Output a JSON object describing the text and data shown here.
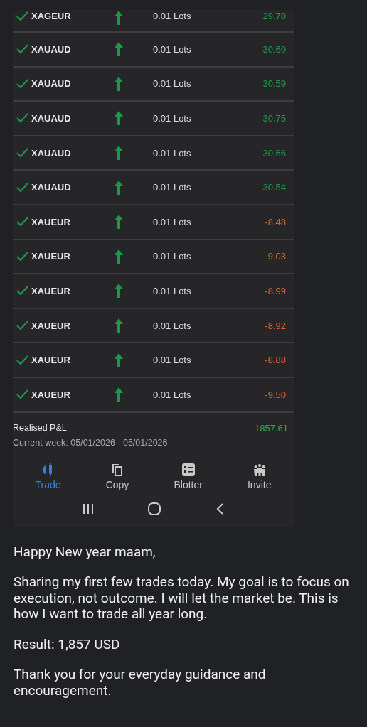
{
  "trades": [
    {
      "symbol": "XAGEUR",
      "lots": "0.01 Lots",
      "pnl": "29.70",
      "color": "#1f9a4a"
    },
    {
      "symbol": "XAUAUD",
      "lots": "0.01 Lots",
      "pnl": "30.60",
      "color": "#1f9a4a"
    },
    {
      "symbol": "XAUAUD",
      "lots": "0.01 Lots",
      "pnl": "30.59",
      "color": "#1f9a4a"
    },
    {
      "symbol": "XAUAUD",
      "lots": "0.01 Lots",
      "pnl": "30.75",
      "color": "#1f9a4a"
    },
    {
      "symbol": "XAUAUD",
      "lots": "0.01 Lots",
      "pnl": "30.66",
      "color": "#1f9a4a"
    },
    {
      "symbol": "XAUAUD",
      "lots": "0.01 Lots",
      "pnl": "30.54",
      "color": "#1f9a4a"
    },
    {
      "symbol": "XAUEUR",
      "lots": "0.01 Lots",
      "pnl": "-8.48",
      "color": "#e0623c"
    },
    {
      "symbol": "XAUEUR",
      "lots": "0.01 Lots",
      "pnl": "-9.03",
      "color": "#e0623c"
    },
    {
      "symbol": "XAUEUR",
      "lots": "0.01 Lots",
      "pnl": "-8.99",
      "color": "#e0623c"
    },
    {
      "symbol": "XAUEUR",
      "lots": "0.01 Lots",
      "pnl": "-8.92",
      "color": "#e0623c"
    },
    {
      "symbol": "XAUEUR",
      "lots": "0.01 Lots",
      "pnl": "-8.88",
      "color": "#e0623c"
    },
    {
      "symbol": "XAUEUR",
      "lots": "0.01 Lots",
      "pnl": "-9.50",
      "color": "#e0623c"
    }
  ],
  "summary": {
    "label": "Realised P&L",
    "value": "1857.61",
    "period": "Current week: 05/01/2026 - 05/01/2026"
  },
  "nav": [
    {
      "label": "Trade",
      "selected": true
    },
    {
      "label": "Copy",
      "selected": false
    },
    {
      "label": "Blotter",
      "selected": false
    },
    {
      "label": "Invite",
      "selected": false
    }
  ],
  "message": [
    "Happy New year maam,",
    "Sharing my first few trades today. My goal is to focus on execution, not outcome. I will let the market be. This is how I want to trade all year long.",
    "Result: 1,857 USD",
    "Thank you for your everyday guidance and encouragement."
  ]
}
